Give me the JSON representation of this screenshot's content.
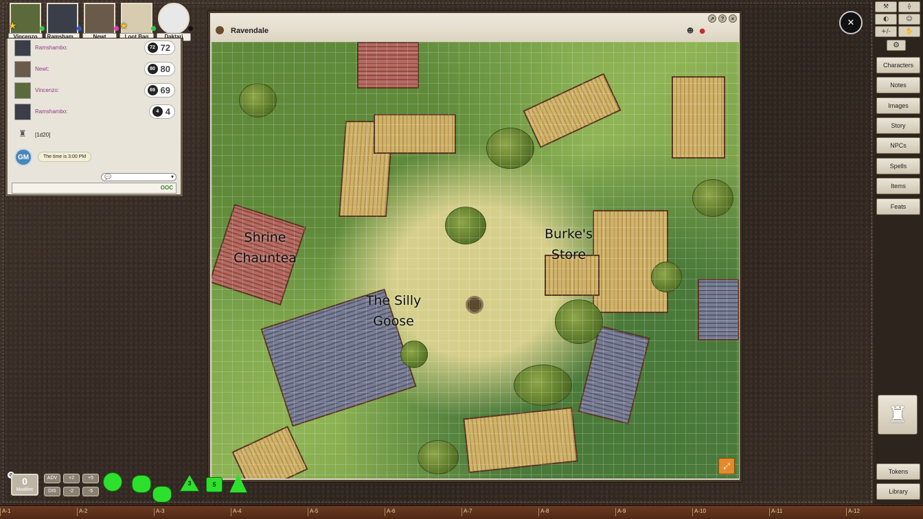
{
  "party": [
    {
      "name": "Vincenzo",
      "star": true,
      "dot_color": "#2ecc40"
    },
    {
      "name": "Ramsham...",
      "star": false,
      "dot_color": "#1e5bd6"
    },
    {
      "name": "Newt",
      "star": false,
      "dot_color": "#e040c0"
    },
    {
      "name": "Loot Bag",
      "star": true,
      "dot_color": "#2ecc40"
    },
    {
      "name": "Daktari",
      "star": false,
      "dot_color": "#111111"
    }
  ],
  "chat": {
    "entries": [
      {
        "speaker": "Ramshambo:",
        "die": "72",
        "result": "72"
      },
      {
        "speaker": "Newt:",
        "die": "80",
        "result": "80"
      },
      {
        "speaker": "Vincenzo:",
        "die": "69",
        "result": "69"
      },
      {
        "speaker": "Ramshambo:",
        "die": "4",
        "result": "4"
      }
    ],
    "roll_note": "[1d20]",
    "gm_badge": "GM",
    "gm_message": "The time is 3:00 PM",
    "mode_label": "OOC"
  },
  "map": {
    "title": "Ravendale",
    "labels": {
      "shrine": [
        "Shrine",
        "Chauntea"
      ],
      "store": [
        "Burke's",
        "Store"
      ],
      "inn": [
        "The Silly",
        "Goose"
      ]
    }
  },
  "toolbar": {
    "tools": [
      "⚒",
      "⟠",
      "◐",
      "☺",
      "+/-",
      "✋"
    ],
    "sidebar": [
      "Characters",
      "Notes",
      "Images",
      "Story",
      "NPCs",
      "Spells",
      "Items",
      "Feats"
    ],
    "bottom": [
      "Tokens",
      "Library"
    ]
  },
  "modifier": {
    "value": "0",
    "label": "Modifier",
    "buttons": [
      "ADV",
      "+2",
      "+5",
      "DIS",
      "-2",
      "-5"
    ]
  },
  "dice": [
    "",
    "",
    "",
    "3",
    "5",
    ""
  ],
  "ruler": [
    "A-1",
    "A-2",
    "A-3",
    "A-4",
    "A-5",
    "A-6",
    "A-7",
    "A-8",
    "A-9",
    "A-10",
    "A-11",
    "A-12"
  ],
  "colors": {
    "accent": "#2ee02e",
    "speaker": "#8a3a8a",
    "gm_badge": "#4a86b8"
  }
}
